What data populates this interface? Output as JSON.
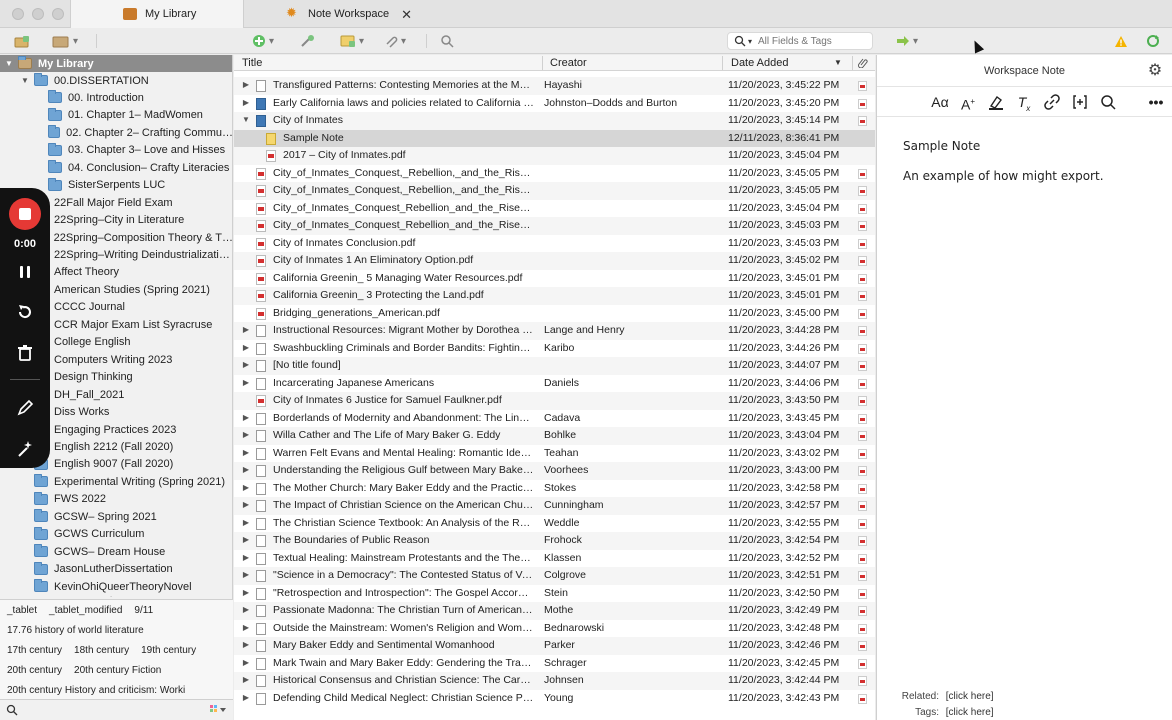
{
  "tabs": [
    {
      "label": "My Library",
      "icon": "library-icon",
      "color": "#c97a2b"
    },
    {
      "label": "Note Workspace",
      "icon": "note-workspace-icon",
      "color": "#e08a1e"
    }
  ],
  "toolbar": {
    "search_placeholder": "All Fields & Tags"
  },
  "library": {
    "root": "My Library",
    "dissertation": "00.DISSERTATION",
    "sub_collections": [
      "00. Introduction",
      "01. Chapter 1– MadWomen",
      "02. Chapter 2– Crafting Commu…",
      "03. Chapter 3– Love and Hisses",
      "04. Conclusion– Crafty Literacies",
      "SisterSerpents LUC"
    ],
    "collections": [
      "22Fall Major Field Exam",
      "22Spring–City in Literature",
      "22Spring–Composition Theory & T…",
      "22Spring–Writing Deindustrializati…",
      "Affect Theory",
      "American Studies (Spring 2021)",
      "CCCC Journal",
      "CCR Major Exam List Syracruse",
      "College English",
      "Computers Writing 2023",
      "Design Thinking",
      "DH_Fall_2021",
      "Diss Works",
      "Engaging Practices 2023",
      "English 2212 (Fall 2020)",
      "English 9007 (Fall 2020)",
      "Experimental Writing (Spring 2021)",
      "FWS 2022",
      "GCSW– Spring 2021",
      "GCWS Curriculum",
      "GCWS– Dream House",
      "JasonLutherDissertation",
      "KevinOhiQueerTheoryNovel"
    ]
  },
  "tags": {
    "rows": [
      [
        "_tablet",
        "_tablet_modified",
        "9/11"
      ],
      [
        "17.76 history of world literature"
      ],
      [
        "17th century",
        "18th century",
        "19th century"
      ],
      [
        "20th century",
        "20th century Fiction"
      ],
      [
        "20th century History and criticism: Worki"
      ]
    ]
  },
  "recorder": {
    "time": "0:00"
  },
  "columns": {
    "title": "Title",
    "creator": "Creator",
    "date_added": "Date Added"
  },
  "items": [
    {
      "type": "doc",
      "exp": "▶",
      "indent": 0,
      "title": "Transfigured Patterns: Contesting Memories at the M…",
      "creator": "Hayashi",
      "date": "11/20/2023, 3:45:22 PM",
      "att": true
    },
    {
      "type": "book",
      "exp": "▶",
      "indent": 0,
      "title": "Early California laws and policies related to California …",
      "creator": "Johnston–Dodds and Burton",
      "date": "11/20/2023, 3:45:20 PM",
      "att": true
    },
    {
      "type": "book",
      "exp": "▼",
      "indent": 0,
      "title": "City of Inmates",
      "creator": "",
      "date": "11/20/2023, 3:45:14 PM",
      "att": true
    },
    {
      "type": "note",
      "exp": "",
      "indent": 1,
      "title": "Sample Note",
      "creator": "",
      "date": "12/11/2023, 8:36:41 PM",
      "att": false,
      "selected": true
    },
    {
      "type": "pdf",
      "exp": "",
      "indent": 1,
      "title": "2017 – City of Inmates.pdf",
      "creator": "",
      "date": "11/20/2023, 3:45:04 PM",
      "att": false
    },
    {
      "type": "pdf",
      "exp": "",
      "indent": 0,
      "title": "City_of_Inmates_Conquest,_Rebellion,_and_the_Rise_…",
      "creator": "",
      "date": "11/20/2023, 3:45:05 PM",
      "att": true
    },
    {
      "type": "pdf",
      "exp": "",
      "indent": 0,
      "title": "City_of_Inmates_Conquest,_Rebellion,_and_the_Rise_…",
      "creator": "",
      "date": "11/20/2023, 3:45:05 PM",
      "att": true
    },
    {
      "type": "pdf",
      "exp": "",
      "indent": 0,
      "title": "City_of_Inmates_Conquest_Rebellion_and_the_Rise_of…",
      "creator": "",
      "date": "11/20/2023, 3:45:04 PM",
      "att": true
    },
    {
      "type": "pdf",
      "exp": "",
      "indent": 0,
      "title": "City_of_Inmates_Conquest_Rebellion_and_the_Rise_of…",
      "creator": "",
      "date": "11/20/2023, 3:45:03 PM",
      "att": true
    },
    {
      "type": "pdf",
      "exp": "",
      "indent": 0,
      "title": "City of Inmates Conclusion.pdf",
      "creator": "",
      "date": "11/20/2023, 3:45:03 PM",
      "att": true
    },
    {
      "type": "pdf",
      "exp": "",
      "indent": 0,
      "title": "City of Inmates 1 An Eliminatory Option.pdf",
      "creator": "",
      "date": "11/20/2023, 3:45:02 PM",
      "att": true
    },
    {
      "type": "pdf",
      "exp": "",
      "indent": 0,
      "title": "California Greenin_ 5 Managing Water Resources.pdf",
      "creator": "",
      "date": "11/20/2023, 3:45:01 PM",
      "att": true
    },
    {
      "type": "pdf",
      "exp": "",
      "indent": 0,
      "title": "California Greenin_ 3 Protecting the Land.pdf",
      "creator": "",
      "date": "11/20/2023, 3:45:01 PM",
      "att": true
    },
    {
      "type": "pdf",
      "exp": "",
      "indent": 0,
      "title": "Bridging_generations_American.pdf",
      "creator": "",
      "date": "11/20/2023, 3:45:00 PM",
      "att": true
    },
    {
      "type": "doc",
      "exp": "▶",
      "indent": 0,
      "title": "Instructional Resources: Migrant Mother by Dorothea …",
      "creator": "Lange and Henry",
      "date": "11/20/2023, 3:44:28 PM",
      "att": true
    },
    {
      "type": "doc",
      "exp": "▶",
      "indent": 0,
      "title": "Swashbuckling Criminals and Border Bandits: Fighting…",
      "creator": "Karibo",
      "date": "11/20/2023, 3:44:26 PM",
      "att": true
    },
    {
      "type": "doc",
      "exp": "▶",
      "indent": 0,
      "title": "[No title found]",
      "creator": "",
      "date": "11/20/2023, 3:44:07 PM",
      "att": true
    },
    {
      "type": "doc",
      "exp": "▶",
      "indent": 0,
      "title": "Incarcerating Japanese Americans",
      "creator": "Daniels",
      "date": "11/20/2023, 3:44:06 PM",
      "att": true
    },
    {
      "type": "pdf",
      "exp": "",
      "indent": 0,
      "title": "City of Inmates 6 Justice for Samuel Faulkner.pdf",
      "creator": "",
      "date": "11/20/2023, 3:43:50 PM",
      "att": true
    },
    {
      "type": "doc",
      "exp": "▶",
      "indent": 0,
      "title": "Borderlands of Modernity and Abandonment: The Lin…",
      "creator": "Cadava",
      "date": "11/20/2023, 3:43:45 PM",
      "att": true
    },
    {
      "type": "doc",
      "exp": "▶",
      "indent": 0,
      "title": "Willa Cather and The Life of Mary Baker G. Eddy",
      "creator": "Bohlke",
      "date": "11/20/2023, 3:43:04 PM",
      "att": true
    },
    {
      "type": "doc",
      "exp": "▶",
      "indent": 0,
      "title": "Warren Felt Evans and Mental Healing: Romantic Ideal…",
      "creator": "Teahan",
      "date": "11/20/2023, 3:43:02 PM",
      "att": true
    },
    {
      "type": "doc",
      "exp": "▶",
      "indent": 0,
      "title": "Understanding the Religious Gulf between Mary Baker…",
      "creator": "Voorhees",
      "date": "11/20/2023, 3:43:00 PM",
      "att": true
    },
    {
      "type": "doc",
      "exp": "▶",
      "indent": 0,
      "title": "The Mother Church: Mary Baker Eddy and the Practice…",
      "creator": "Stokes",
      "date": "11/20/2023, 3:42:58 PM",
      "att": true
    },
    {
      "type": "doc",
      "exp": "▶",
      "indent": 0,
      "title": "The Impact of Christian Science on the American Chu…",
      "creator": "Cunningham",
      "date": "11/20/2023, 3:42:57 PM",
      "att": true
    },
    {
      "type": "doc",
      "exp": "▶",
      "indent": 0,
      "title": "The Christian Science Textbook: An Analysis of the Re…",
      "creator": "Weddle",
      "date": "11/20/2023, 3:42:55 PM",
      "att": true
    },
    {
      "type": "doc",
      "exp": "▶",
      "indent": 0,
      "title": "The Boundaries of Public Reason",
      "creator": "Frohock",
      "date": "11/20/2023, 3:42:54 PM",
      "att": true
    },
    {
      "type": "doc",
      "exp": "▶",
      "indent": 0,
      "title": "Textual Healing: Mainstream Protestants and the Ther…",
      "creator": "Klassen",
      "date": "11/20/2023, 3:42:52 PM",
      "att": true
    },
    {
      "type": "doc",
      "exp": "▶",
      "indent": 0,
      "title": "\"Science in a Democracy\": The Contested Status of Va…",
      "creator": "Colgrove",
      "date": "11/20/2023, 3:42:51 PM",
      "att": true
    },
    {
      "type": "doc",
      "exp": "▶",
      "indent": 0,
      "title": "\"Retrospection and Introspection\": The Gospel Accord…",
      "creator": "Stein",
      "date": "11/20/2023, 3:42:50 PM",
      "att": true
    },
    {
      "type": "doc",
      "exp": "▶",
      "indent": 0,
      "title": "Passionate Madonna: The Christian Turn of American …",
      "creator": "Mothe",
      "date": "11/20/2023, 3:42:49 PM",
      "att": true
    },
    {
      "type": "doc",
      "exp": "▶",
      "indent": 0,
      "title": "Outside the Mainstream: Women's Religion and Wome…",
      "creator": "Bednarowski",
      "date": "11/20/2023, 3:42:48 PM",
      "att": true
    },
    {
      "type": "doc",
      "exp": "▶",
      "indent": 0,
      "title": "Mary Baker Eddy and Sentimental Womanhood",
      "creator": "Parker",
      "date": "11/20/2023, 3:42:46 PM",
      "att": true
    },
    {
      "type": "doc",
      "exp": "▶",
      "indent": 0,
      "title": "Mark Twain and Mary Baker Eddy: Gendering the Tran…",
      "creator": "Schrager",
      "date": "11/20/2023, 3:42:45 PM",
      "att": true
    },
    {
      "type": "doc",
      "exp": "▶",
      "indent": 0,
      "title": "Historical Consensus and Christian Science: The Care…",
      "creator": "Johnsen",
      "date": "11/20/2023, 3:42:44 PM",
      "att": true
    },
    {
      "type": "doc",
      "exp": "▶",
      "indent": 0,
      "title": "Defending Child Medical Neglect: Christian Science Pe…",
      "creator": "Young",
      "date": "11/20/2023, 3:42:43 PM",
      "att": true
    }
  ],
  "note_pane": {
    "header": "Workspace Note",
    "note_title": "Sample Note",
    "note_text": "An example of how might export.",
    "related_label": "Related:",
    "related_value": "[click here]",
    "tags_label": "Tags:",
    "tags_value": "[click here]"
  },
  "colors": {
    "accent_green": "#4caf50",
    "warning": "#f5b400",
    "recorder_bg": "#121212",
    "record_red": "#e53935"
  }
}
